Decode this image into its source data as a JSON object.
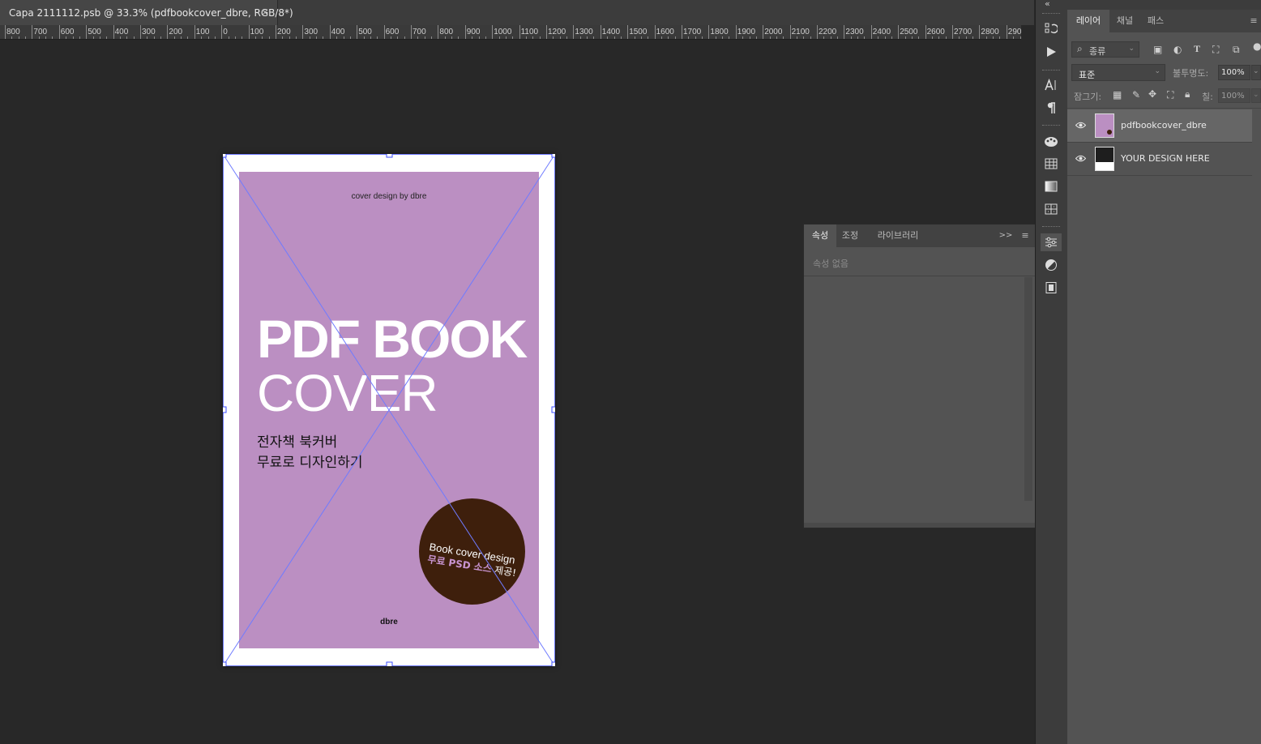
{
  "document_tab": {
    "title": "Capa 2111112.psb @ 33.3% (pdfbookcover_dbre, RGB/8*)",
    "close_glyph": "×"
  },
  "ruler": {
    "labels": [
      "800",
      "700",
      "600",
      "500",
      "400",
      "300",
      "200",
      "100",
      "0",
      "100",
      "200",
      "300",
      "400",
      "500",
      "600",
      "700",
      "800",
      "900",
      "1000",
      "1100",
      "1200",
      "1300",
      "1400",
      "1500",
      "1600",
      "1700",
      "1800",
      "1900",
      "2000",
      "2100",
      "2200",
      "2300",
      "2400",
      "2500",
      "2600",
      "2700",
      "2800",
      "290"
    ]
  },
  "cover": {
    "credit": "cover design by dbre",
    "title_line1": "PDF BOOK",
    "title_line2": "COVER",
    "subtitle_line1": "전자책 북커버",
    "subtitle_line2": "무료로 디자인하기",
    "badge_line1": "Book cover design",
    "badge_line2_highlight": "무료 PSD 소스",
    "badge_line2_rest": " 제공!",
    "brand": "dbre",
    "colors": {
      "background": "#bb8fc2",
      "badge": "#3e1f0c",
      "paper": "#ffffff"
    }
  },
  "properties_panel": {
    "tabs": [
      "속성",
      "조정",
      "라이브러리"
    ],
    "selected_tab": "속성",
    "empty_text": "속성 없음",
    "collapse_glyph": ">>",
    "menu_glyph": "≡"
  },
  "layers_panel": {
    "tabs": [
      "레이어",
      "채널",
      "패스"
    ],
    "selected_tab": "레이어",
    "filter_label": "종류",
    "blend_mode": "표준",
    "opacity_label": "불투명도:",
    "opacity_value": "100%",
    "lock_label": "잠그기:",
    "fill_label": "칠:",
    "fill_value": "100%",
    "layers": [
      {
        "name": "pdfbookcover_dbre",
        "visible": true,
        "selected": true
      },
      {
        "name": "YOUR DESIGN HERE",
        "visible": true,
        "selected": false
      }
    ]
  },
  "collapse_glyph": "«",
  "vertical_strip_icons": [
    "history-icon",
    "play-action-icon",
    "character-icon",
    "paragraph-icon",
    "swatches-icon",
    "table-grid-icon",
    "gradient-icon",
    "pattern-icon",
    "properties-sliders-icon",
    "adjustments-icon",
    "libraries-icon"
  ]
}
